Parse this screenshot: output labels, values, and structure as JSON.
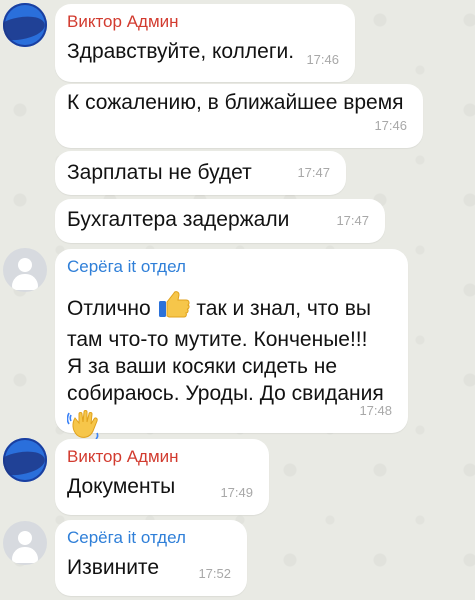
{
  "chat": {
    "messages": [
      {
        "id": 1,
        "sender": "Виктор Админ",
        "text": "Здравствуйте, коллеги.",
        "time": "17:46"
      },
      {
        "id": 2,
        "text": "К сожалению, в ближайшее время",
        "time": "17:46"
      },
      {
        "id": 3,
        "text": "Зарплаты не будет",
        "time": "17:47"
      },
      {
        "id": 4,
        "text": "Бухгалтера задержали",
        "time": "17:47"
      },
      {
        "id": 5,
        "sender": "Серёга it отдел",
        "text_before_emoji": "Отлично",
        "emoji_thumbs": "thumbs-up-icon",
        "text_after_emoji": "так и знал, что вы",
        "text_rest": "там что-то мутите. Конченые!!!\nЯ за ваши косяки сидеть не\nсобираюсь. Уроды. До свидания",
        "emoji_wave": "waving-hand-icon",
        "time": "17:48"
      },
      {
        "id": 6,
        "sender": "Виктор Админ",
        "text": "Документы",
        "time": "17:49"
      },
      {
        "id": 7,
        "sender": "Серёга it отдел",
        "text": "Извините",
        "time": "17:52"
      }
    ]
  },
  "colors": {
    "admin_name": "#d23b2f",
    "it_name": "#2f7fd8",
    "background": "#e9eae4",
    "bubble": "#ffffff",
    "time": "#a8a8a8"
  }
}
